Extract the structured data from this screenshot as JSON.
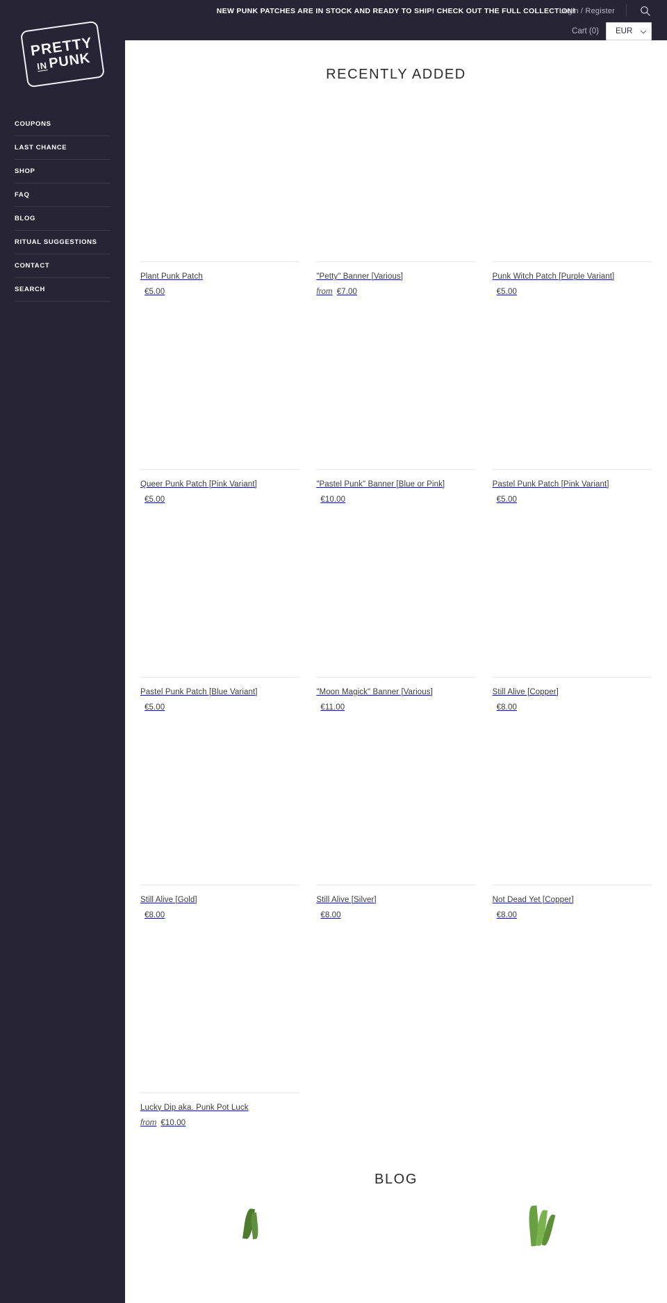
{
  "sidebar": {
    "logo": {
      "line1": "PRETTY",
      "in": "IN",
      "line2": "PUNK",
      "alt": "Pretty in Punk logo stamp"
    },
    "items": [
      {
        "label": "COUPONS"
      },
      {
        "label": "LAST CHANCE"
      },
      {
        "label": "SHOP"
      },
      {
        "label": "FAQ"
      },
      {
        "label": "BLOG"
      },
      {
        "label": "RITUAL SUGGESTIONS"
      },
      {
        "label": "CONTACT"
      },
      {
        "label": "SEARCH"
      }
    ]
  },
  "topbar": {
    "announcement": "NEW PUNK PATCHES ARE IN STOCK AND READY TO SHIP! CHECK OUT THE FULL COLLECTION!",
    "account_label": "Login / Register",
    "search_icon": "search-icon",
    "cart_label": "Cart (0)",
    "currency_selected": "EUR",
    "currency_options": [
      "EUR"
    ]
  },
  "main": {
    "recently_added_title": "RECENTLY ADDED",
    "blog_title": "BLOG",
    "products": [
      {
        "title": "Plant Punk Patch",
        "from": "",
        "price": "€5.00"
      },
      {
        "title": "\"Petty\" Banner [Various]",
        "from": "from",
        "price": "€7.00"
      },
      {
        "title": "Punk Witch Patch [Purple Variant]",
        "from": "",
        "price": "€5.00"
      },
      {
        "title": "Queer Punk Patch [Pink Variant]",
        "from": "",
        "price": "€5.00"
      },
      {
        "title": "\"Pastel Punk\" Banner [Blue or Pink]",
        "from": "",
        "price": "€10.00"
      },
      {
        "title": "Pastel Punk Patch [Pink Variant]",
        "from": "",
        "price": "€5.00"
      },
      {
        "title": "Pastel Punk Patch [Blue Variant]",
        "from": "",
        "price": "€5.00"
      },
      {
        "title": "\"Moon Magick\" Banner [Various]",
        "from": "",
        "price": "€11.00"
      },
      {
        "title": "Still Alive [Copper]",
        "from": "",
        "price": "€8.00"
      },
      {
        "title": "Still Alive [Gold]",
        "from": "",
        "price": "€8.00"
      },
      {
        "title": "Still Alive [Silver]",
        "from": "",
        "price": "€8.00"
      },
      {
        "title": "Not Dead Yet [Copper]",
        "from": "",
        "price": "€8.00"
      },
      {
        "title": "Lucky Dip aka. Punk Pot Luck",
        "from": "from",
        "price": "€10.00"
      }
    ]
  },
  "colors": {
    "sidebar_bg": "#272435",
    "topbar_bg": "#272435",
    "text_light": "#ffffff",
    "text_muted": "#b9b7c6",
    "body_bg": "#ffffff",
    "product_text": "#3a3a3a",
    "rule": "#e7e7ea"
  }
}
